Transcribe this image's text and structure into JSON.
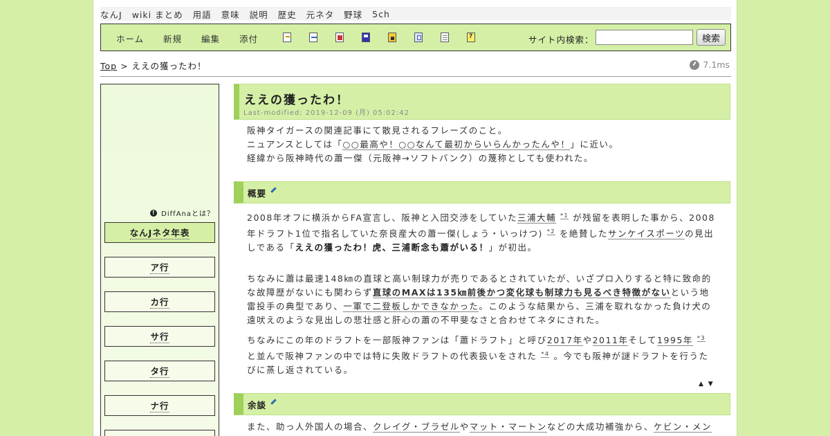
{
  "topnav": [
    "なんJ",
    "wiki まとめ",
    "用語",
    "意味",
    "説明",
    "歴史",
    "元ネタ",
    "野球",
    "5ch"
  ],
  "toolbar": {
    "links": [
      "ホーム",
      "新規",
      "編集",
      "添付"
    ],
    "icons": [
      "new-page-icon",
      "edit-page-icon",
      "diff-icon",
      "save-icon",
      "lock-icon",
      "copy-icon",
      "list-icon",
      "help-icon"
    ],
    "search_label": "サイト内検索：",
    "search_value": "",
    "search_button": "検索"
  },
  "breadcrumb": {
    "top": "Top",
    "sep": ">",
    "current": "ええの獲ったわ！"
  },
  "timing": "7.1ms",
  "sidebar": {
    "diffana": "DiffAnaとは？",
    "items": [
      "なんJネタ年表",
      "ア行",
      "カ行",
      "サ行",
      "タ行",
      "ナ行"
    ]
  },
  "article": {
    "title": "ええの獲ったわ！",
    "last_modified": "Last-modified: 2019-12-09 (月) 05:02:42",
    "intro": [
      "阪神タイガースの関連記事にて散見されるフレーズのこと。",
      "ニュアンスとしては「",
      "○○最高や！○○なんて最初からいらんかったんや！",
      "」に近い。",
      "経緯から阪神時代の蕭一傑（元阪神→ソフトバンク）の蔑称としても使われた。"
    ],
    "sec1": {
      "heading": "概要",
      "p1": [
        "2008年オフに横浜からFA宣言し、阪神と入団交渉をしていた",
        "三浦大輔",
        "*1",
        "が残留を表明した事から、2008年ドラフト1位で指名していた奈良産大の蕭一傑(しょう・いっけつ)",
        "*2",
        "を絶賛した",
        "サンケイスポーツ",
        "の見出しである「",
        "ええの獲ったわ！虎、三浦断念も蕭がいる！",
        "」が初出。"
      ],
      "p2": [
        "ちなみに蕭は最速148㎞の直球と高い制球力が売りであるとされていたが、いざプロ入りすると特に致命的な故障歴がないにも関わらず",
        "直球のMAXは135㎞前後かつ変化球も制球力も見るべき特徴がない",
        "という地雷投手の典型であり、",
        "一軍で二登板しかできなかった",
        "。このような結果から、三浦を取れなかった負け犬の遠吠えのような見出しの悲壮感と肝心の蕭の不甲斐なさと合わせてネタにされた。"
      ],
      "p3": [
        "ちなみにこの年のドラフトを一部阪神ファンは「蕭ドラフト」と呼び",
        "2017年",
        "や",
        "2011年",
        "そして",
        "1995年",
        "*3",
        "と並んで阪神ファンの中では特に失敗ドラフトの代表扱いをされた",
        "*4",
        "。今でも阪神が謎ドラフトを行うたびに蒸し返されている。"
      ]
    },
    "sec2": {
      "heading": "余談",
      "p1": [
        "また、助っ人外国人の場合、",
        "クレイグ・ブラゼル",
        "や",
        "マット・マートン",
        "などの大成功補強から、",
        "ケビン・メンチ"
      ]
    },
    "jump": "▲ ▼"
  }
}
